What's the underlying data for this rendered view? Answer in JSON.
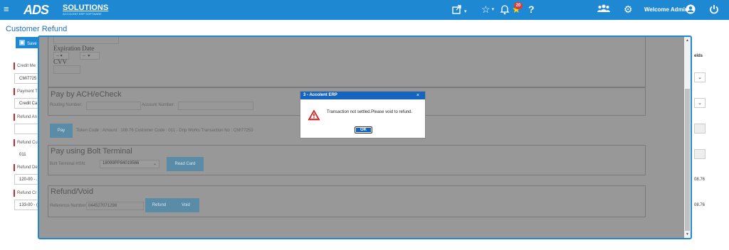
{
  "header": {
    "logo_mark": "ADS",
    "logo_name": "SOLUTIONS",
    "logo_tagline": "ACCOLENT ERP SOFTWARE",
    "notification_count": "20",
    "welcome": "Welcome Admin"
  },
  "page": {
    "title": "Customer Refund",
    "save_label": "Save",
    "fields": [
      {
        "label": "Credit Me",
        "value": "CMI7725"
      },
      {
        "label": "Payment T",
        "value": "Credit Ca"
      },
      {
        "label": "Refund An",
        "value": ""
      },
      {
        "label": "Refund Cu",
        "value": "011"
      },
      {
        "label": "Refund De",
        "value": "120-00 - ."
      },
      {
        "label": "Refund Cr",
        "value": "133-00 - ("
      }
    ],
    "right_header": "elds",
    "right_amount_1": "08.76",
    "right_amount_2": "08.76"
  },
  "modal": {
    "expiration_label": "Expiration Date",
    "month_value": "--",
    "year_value": "--",
    "cvv_label": "CVV",
    "ach_title": "Pay by ACH/eCheck",
    "routing_label": "Routing Number:",
    "account_label": "Account Number:",
    "pay_label": "Pay",
    "token_info": "Token Code : Amount : 108.76 Customer Code : 011 - Drip Works Transaction No : CMI77253",
    "bolt_title": "Pay using Bolt Terminal",
    "bolt_hsn_label": "Bolt Terminal HSN:",
    "bolt_hsn_value": "18099PP84019566",
    "read_card_label": "Read Card",
    "refund_title": "Refund/Void",
    "reference_label": "Reference Number:",
    "reference_value": "044527071298",
    "refund_label": "Refund",
    "void_label": "Void"
  },
  "dialog": {
    "title": "3 - Accolent ERP",
    "close": "×",
    "message": "Transaction not settled.Please void to refund.",
    "ok_label": "OK"
  },
  "colors": {
    "brand": "#1e88d2",
    "dialog_header": "#1565c0",
    "button_teal": "#5a8ca7",
    "required_marker": "#c62828"
  }
}
